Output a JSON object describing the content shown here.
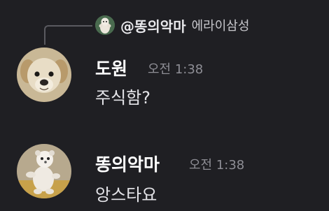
{
  "reply": {
    "author": "@똥의악마",
    "text": "에라이삼성"
  },
  "messages": [
    {
      "author": "도원",
      "timestamp": "오전 1:38",
      "content": "주식함?",
      "avatar": "dog-avatar"
    },
    {
      "author": "똥의악마",
      "timestamp": "오전 1:38",
      "content": "앙스타요",
      "avatar": "plush-avatar"
    }
  ],
  "colors": {
    "background": "#1f1f23",
    "author": "#ffffff",
    "timestamp": "#8e8e95",
    "content": "#e4e4e8"
  }
}
